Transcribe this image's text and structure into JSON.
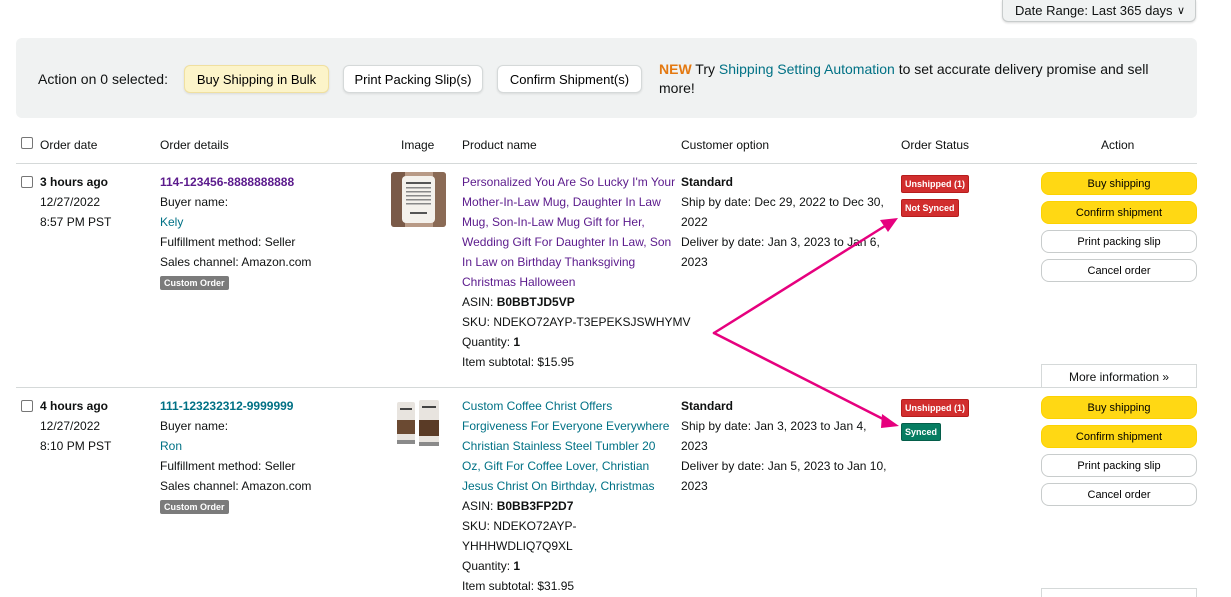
{
  "date_range": {
    "label": "Date Range: Last 365 days"
  },
  "action_bar": {
    "label": "Action on 0 selected:",
    "buy_bulk": "Buy Shipping in Bulk",
    "print_slip": "Print Packing Slip(s)",
    "confirm": "Confirm Shipment(s)",
    "promo_new": "NEW",
    "promo_try": " Try ",
    "promo_link": "Shipping Setting Automation",
    "promo_rest": " to set accurate delivery promise and sell more!"
  },
  "columns": [
    "Order date",
    "Order details",
    "Image",
    "Product name",
    "Customer option",
    "Order Status",
    "Action"
  ],
  "orders": [
    {
      "age": "3 hours ago",
      "date": "12/27/2022",
      "time": "8:57 PM PST",
      "order_id": "114-123456-8888888888",
      "buyer_label": "Buyer name:",
      "buyer": "Kely",
      "fulfillment": "Fulfillment method: Seller",
      "channel": "Sales channel: Amazon.com",
      "tag": "Custom Order",
      "product": [
        "Personalized You Are So Lucky I'm Your",
        "Mother-In-Law Mug, Daughter In Law",
        "Mug, Son-In-Law Mug Gift for Her,",
        "Wedding Gift For Daughter In Law, Son",
        "In Law on Birthday Thanksgiving",
        "Christmas Halloween"
      ],
      "asin_label": "ASIN: ",
      "asin": "B0BBTJD5VP",
      "sku": [
        "SKU: NDEKO72AYP-T3EPEKSJSWHYMV"
      ],
      "qty_label": "Quantity: ",
      "qty": "1",
      "subtotal": "Item subtotal: $15.95",
      "option": "Standard",
      "ship_by": [
        "Ship by date: Dec 29, 2022 to Dec 30,",
        "2022"
      ],
      "deliver_by": [
        "Deliver by date: Jan 3, 2023 to Jan 6,",
        "2023"
      ],
      "status1": "Unshipped (1)",
      "status2": "Not Synced",
      "actions": [
        "Buy shipping",
        "Confirm shipment",
        "Print packing slip",
        "Cancel order"
      ],
      "more_info": "More information »"
    },
    {
      "age": "4 hours ago",
      "date": "12/27/2022",
      "time": "8:10 PM PST",
      "order_id": "111-123232312-9999999",
      "buyer_label": "Buyer name:",
      "buyer": "Ron",
      "fulfillment": "Fulfillment method: Seller",
      "channel": "Sales channel: Amazon.com",
      "tag": "Custom Order",
      "product": [
        "Custom Coffee Christ Offers",
        "Forgiveness For Everyone Everywhere",
        "Christian Stainless Steel Tumbler 20",
        "Oz, Gift For Coffee Lover, Christian",
        "Jesus Christ On Birthday, Christmas"
      ],
      "asin_label": "ASIN: ",
      "asin": "B0BB3FP2D7",
      "sku": [
        "SKU: NDEKO72AYP-",
        "YHHHWDLIQ7Q9XL"
      ],
      "qty_label": "Quantity: ",
      "qty": "1",
      "subtotal": "Item subtotal: $31.95",
      "option": "Standard",
      "ship_by": [
        "Ship by date: Jan 3, 2023 to Jan 4,",
        "2023"
      ],
      "deliver_by": [
        "Deliver by date: Jan 5, 2023 to Jan 10,",
        "2023"
      ],
      "status1": "Unshipped (1)",
      "status2": "Synced",
      "actions": [
        "Buy shipping",
        "Confirm shipment",
        "Print packing slip",
        "Cancel order"
      ]
    }
  ],
  "colors": {
    "accent_yellow": "#ffd814",
    "link_teal": "#007185",
    "annotation_pink": "#e6007e",
    "status_red": "#d12e2e",
    "status_green": "#067d62"
  }
}
